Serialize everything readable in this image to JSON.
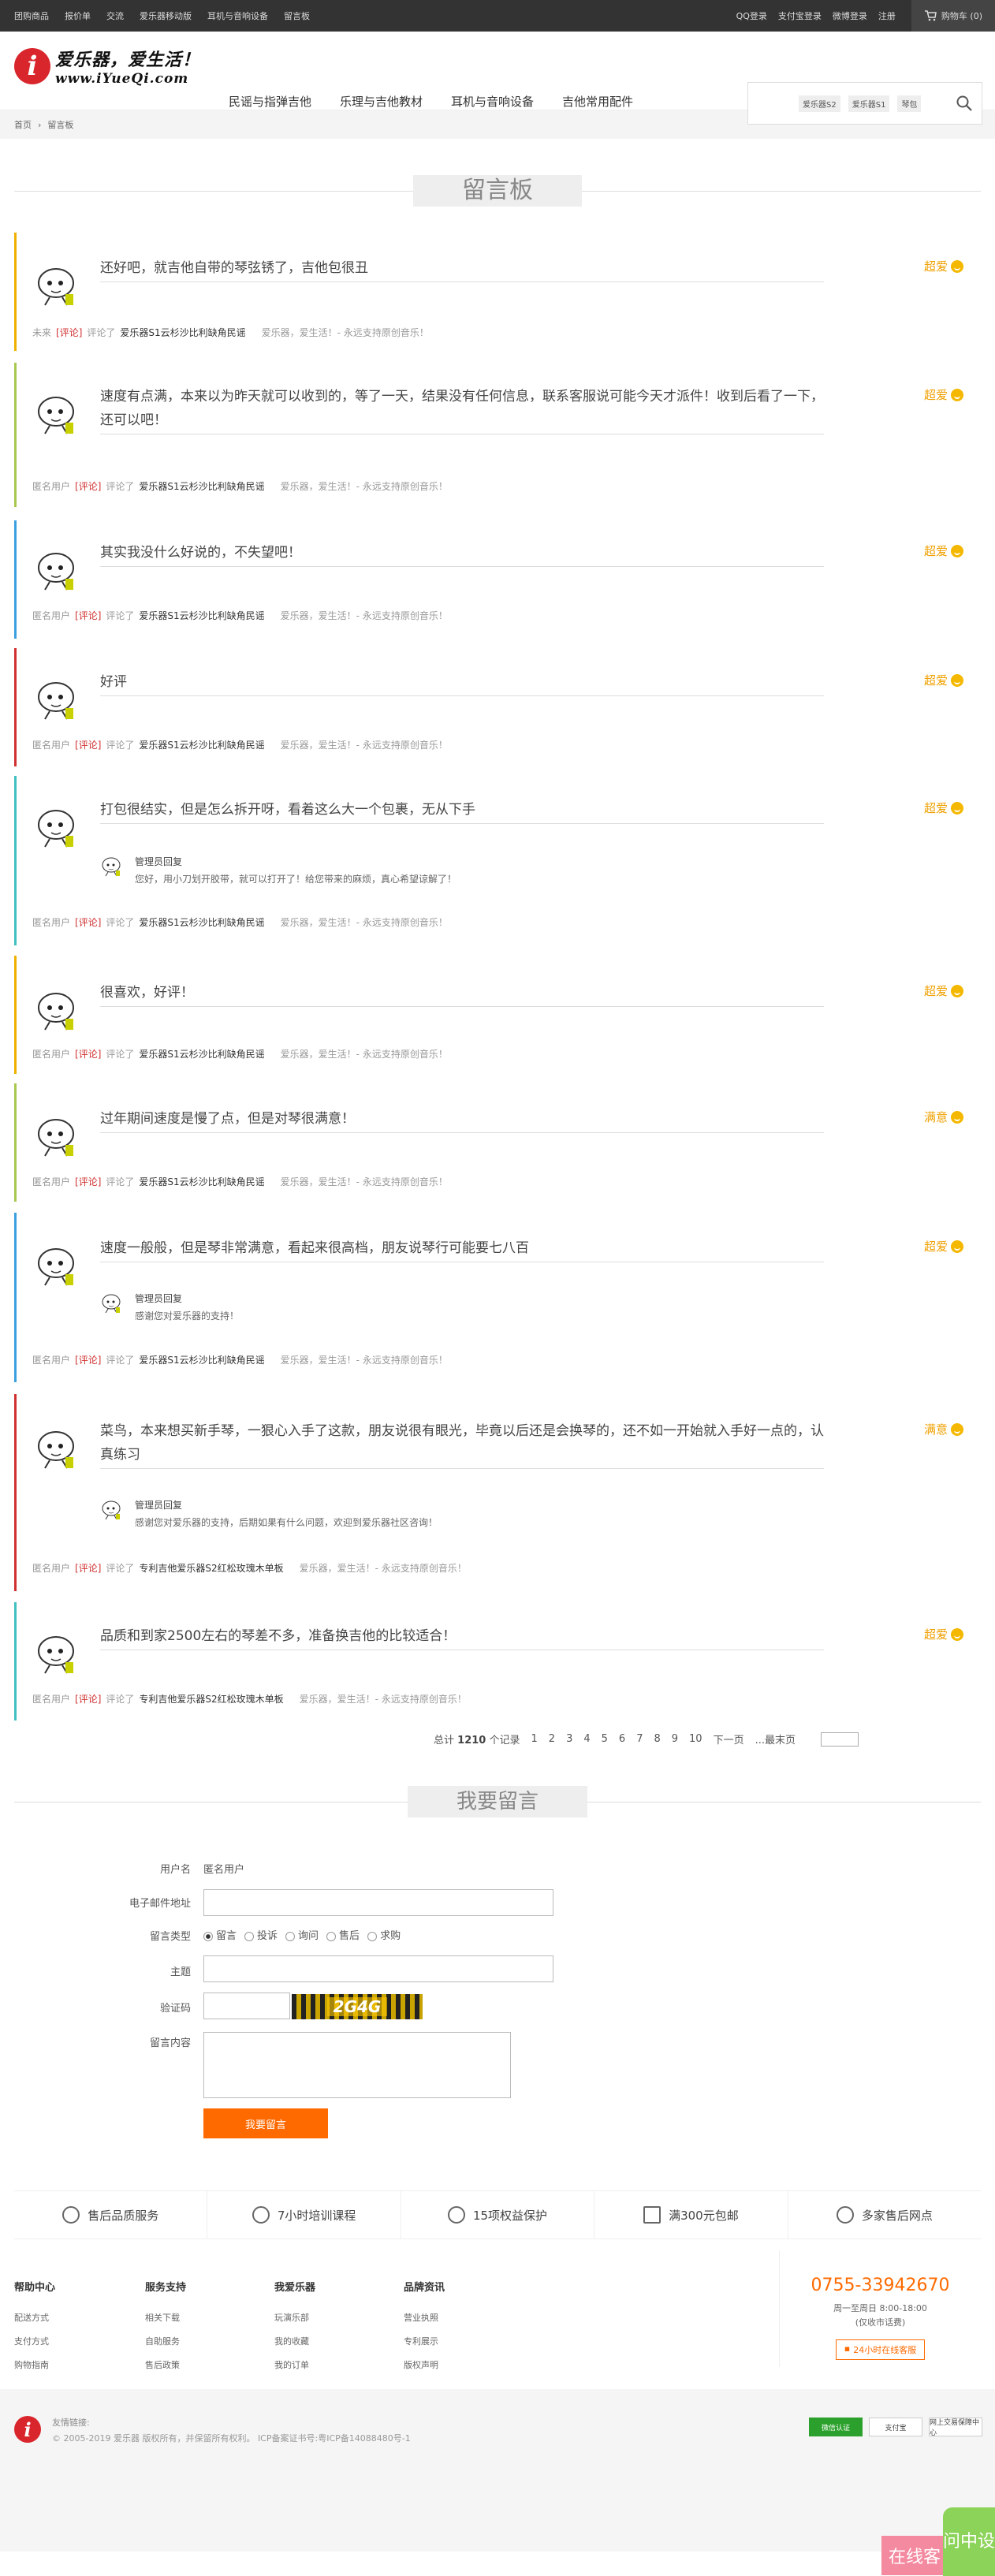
{
  "topbar": {
    "left_links": [
      "团购商品",
      "报价单",
      "交流",
      "爱乐器移动版",
      "耳机与音响设备",
      "留言板"
    ],
    "right_links": [
      "QQ登录",
      "支付宝登录",
      "微博登录",
      "注册"
    ],
    "cart": "购物车 (0)"
  },
  "logo": {
    "mark": "i",
    "slogan": "爱乐器，爱生活！",
    "url": "www.iYueQi.com"
  },
  "nav": [
    "民谣与指弹吉他",
    "乐理与吉他教材",
    "耳机与音响设备",
    "吉他常用配件"
  ],
  "search": {
    "tags": [
      "爱乐器S2",
      "爱乐器S1",
      "琴包"
    ]
  },
  "breadcrumb": [
    "首页",
    "留言板"
  ],
  "board_title": "留言板",
  "comment_label": "[评论]",
  "comment_verb": "评论了",
  "slogan_tail": "爱乐器，爱生活！- 永远支持原创音乐！",
  "reply_author": "管理员回复",
  "messages": [
    {
      "user": "未来",
      "text": "还好吧，就吉他自带的琴弦锈了，吉他包很丑",
      "rating": "超爱",
      "product": "爱乐器S1云杉沙比利缺角民谣"
    },
    {
      "user": "匿名用户",
      "text": "速度有点满，本来以为昨天就可以收到的，等了一天，结果没有任何信息，联系客服说可能今天才派件！收到后看了一下，还可以吧！",
      "rating": "超爱",
      "product": "爱乐器S1云杉沙比利缺角民谣"
    },
    {
      "user": "匿名用户",
      "text": "其实我没什么好说的，不失望吧！",
      "rating": "超爱",
      "product": "爱乐器S1云杉沙比利缺角民谣"
    },
    {
      "user": "匿名用户",
      "text": "好评",
      "rating": "超爱",
      "product": "爱乐器S1云杉沙比利缺角民谣"
    },
    {
      "user": "匿名用户",
      "text": "打包很结实，但是怎么拆开呀，看着这么大一个包裹，无从下手",
      "rating": "超爱",
      "product": "爱乐器S1云杉沙比利缺角民谣",
      "reply": "您好，用小刀划开胶带，就可以打开了！给您带来的麻烦，真心希望谅解了！"
    },
    {
      "user": "匿名用户",
      "text": "很喜欢，好评！",
      "rating": "超爱",
      "product": "爱乐器S1云杉沙比利缺角民谣"
    },
    {
      "user": "匿名用户",
      "text": "过年期间速度是慢了点，但是对琴很满意！",
      "rating": "满意",
      "product": "爱乐器S1云杉沙比利缺角民谣"
    },
    {
      "user": "匿名用户",
      "text": "速度一般般，但是琴非常满意，看起来很高档，朋友说琴行可能要七八百",
      "rating": "超爱",
      "product": "爱乐器S1云杉沙比利缺角民谣",
      "reply": "感谢您对爱乐器的支持！"
    },
    {
      "user": "匿名用户",
      "text": "菜鸟，本来想买新手琴，一狠心入手了这款，朋友说很有眼光，毕竟以后还是会换琴的，还不如一开始就入手好一点的，认真练习",
      "rating": "满意",
      "product": "专利吉他爱乐器S2红松玫瑰木单板",
      "reply": "感谢您对爱乐器的支持，后期如果有什么问题，欢迎到爱乐器社区咨询！"
    },
    {
      "user": "匿名用户",
      "text": "品质和到家2500左右的琴差不多，准备换吉他的比较适合！",
      "rating": "超爱",
      "product": "专利吉他爱乐器S2红松玫瑰木单板"
    }
  ],
  "pager": {
    "total_label": "总计",
    "total": "1210",
    "unit": "个记录",
    "pages": [
      "1",
      "2",
      "3",
      "4",
      "5",
      "6",
      "7",
      "8",
      "9",
      "10"
    ],
    "next": "下一页",
    "last": "...最末页"
  },
  "form": {
    "title": "我要留言",
    "user_label": "用户名",
    "user_value": "匿名用户",
    "email_label": "电子邮件地址",
    "type_label": "留言类型",
    "types": [
      "留言",
      "投诉",
      "询问",
      "售后",
      "求购"
    ],
    "subject_label": "主题",
    "captcha_label": "验证码",
    "captcha_text": "2G4G",
    "content_label": "留言内容",
    "submit": "我要留言"
  },
  "services": [
    "售后品质服务",
    "7小时培训课程",
    "15项权益保护",
    "满300元包邮",
    "多家售后网点"
  ],
  "footer_cols": [
    {
      "title": "帮助中心",
      "items": [
        "配送方式",
        "支付方式",
        "购物指南"
      ]
    },
    {
      "title": "服务支持",
      "items": [
        "相关下载",
        "自助服务",
        "售后政策"
      ]
    },
    {
      "title": "我爱乐器",
      "items": [
        "玩演乐部",
        "我的收藏",
        "我的订单"
      ]
    },
    {
      "title": "品牌资讯",
      "items": [
        "营业执照",
        "专利展示",
        "版权声明"
      ]
    }
  ],
  "contact": {
    "phone": "0755-33942670",
    "hours": "周一至周日 8:00-18:00",
    "note": "(仅收市话费)",
    "online": "24小时在线客服"
  },
  "copyright": {
    "links": "友情链接:",
    "text": "© 2005-2019 爱乐器 版权所有，并保留所有权利。 ICP备案证书号:粤ICP备14088480号-1"
  },
  "badges": [
    "微信认证",
    "支付宝",
    "网上交易保障中心"
  ],
  "float": {
    "chat": "在线客",
    "guide": "问中设"
  },
  "colors": {
    "accent": "#ff6a00",
    "rating": "#f0a000",
    "brand_red": "#d9262c"
  }
}
